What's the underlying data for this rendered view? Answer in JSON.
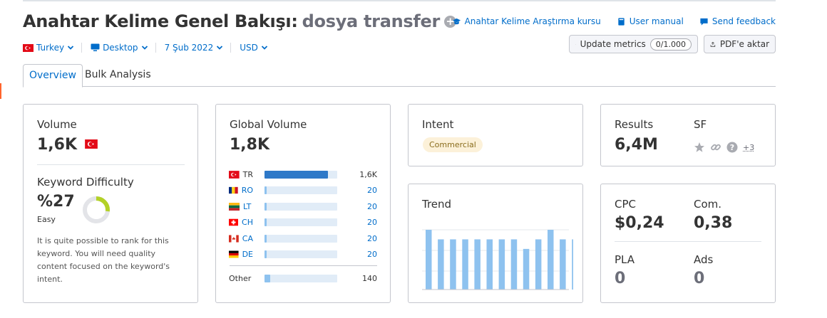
{
  "header": {
    "title": "Anahtar Kelime Genel Bakışı:",
    "keyword": "dosya transfer",
    "links": {
      "course": "Anahtar Kelime Araştırma kursu",
      "manual": "User manual",
      "feedback": "Send feedback"
    }
  },
  "filters": {
    "country": "Turkey",
    "device": "Desktop",
    "date": "7 Şub 2022",
    "currency": "USD"
  },
  "actions": {
    "update_label": "Update metrics",
    "update_count": "0/1.000",
    "export_label": "PDF'e aktar"
  },
  "tabs": [
    "Overview",
    "Bulk Analysis"
  ],
  "volume": {
    "label": "Volume",
    "value": "1,6K"
  },
  "difficulty": {
    "label": "Keyword Difficulty",
    "value": "%27",
    "level": "Easy",
    "percent": 27,
    "color": "#b3d127",
    "description": "It is quite possible to rank for this keyword. You will need quality content focused on the keyword's intent."
  },
  "global_volume": {
    "label": "Global Volume",
    "value": "1,8K",
    "rows": [
      {
        "code": "TR",
        "flag": "tr",
        "value": "1,6K",
        "fraction": 0.87
      },
      {
        "code": "RO",
        "flag": "ro",
        "value": "20",
        "fraction": 0.03
      },
      {
        "code": "LT",
        "flag": "lt",
        "value": "20",
        "fraction": 0.03
      },
      {
        "code": "CH",
        "flag": "ch",
        "value": "20",
        "fraction": 0.03
      },
      {
        "code": "CA",
        "flag": "ca",
        "value": "20",
        "fraction": 0.03
      },
      {
        "code": "DE",
        "flag": "de",
        "value": "20",
        "fraction": 0.03
      }
    ],
    "other_label": "Other",
    "other_value": "140",
    "other_fraction": 0.08
  },
  "intent": {
    "label": "Intent",
    "badge": "Commercial"
  },
  "results": {
    "label": "Results",
    "value": "6,4M",
    "sf_label": "SF",
    "sf_icons": [
      "star-icon",
      "link-icon",
      "question-icon"
    ],
    "sf_more": "+3"
  },
  "trend": {
    "label": "Trend",
    "values": [
      1.0,
      0.84,
      0.84,
      0.84,
      0.84,
      0.84,
      0.84,
      0.84,
      0.68,
      0.84,
      1.0,
      0.84,
      0.84
    ]
  },
  "metrics": {
    "cpc_label": "CPC",
    "cpc_value": "$0,24",
    "com_label": "Com.",
    "com_value": "0,38",
    "pla_label": "PLA",
    "pla_value": "0",
    "ads_label": "Ads",
    "ads_value": "0"
  }
}
